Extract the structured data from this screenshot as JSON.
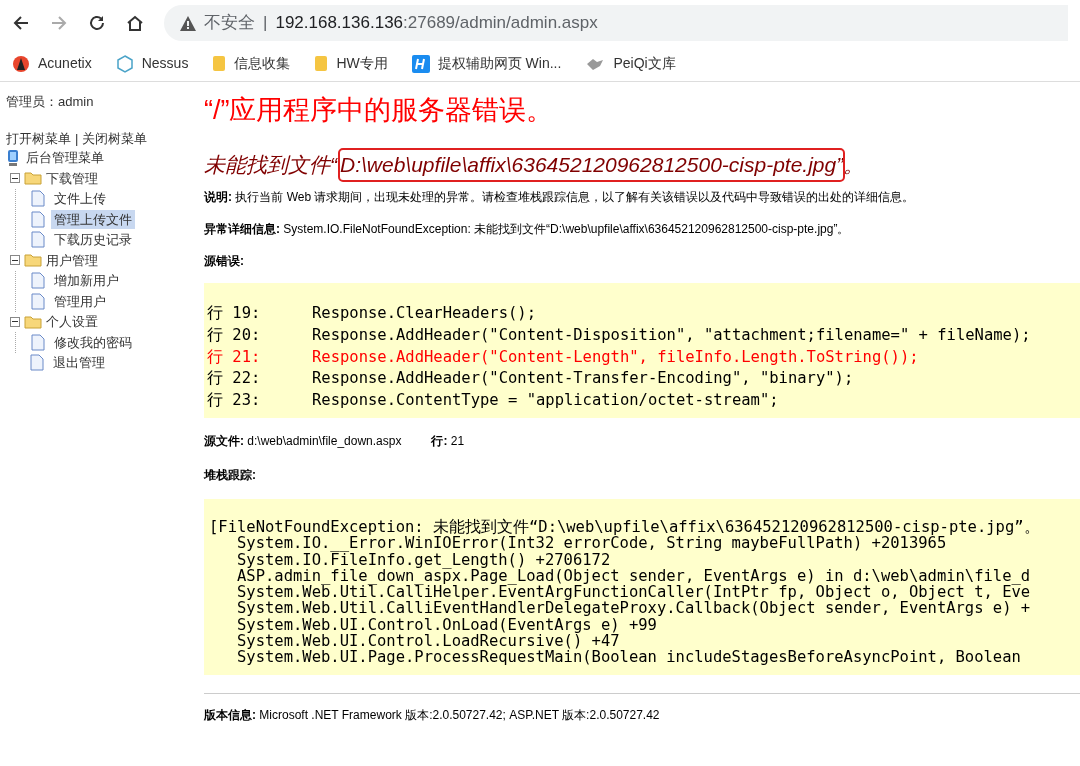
{
  "browser": {
    "security_label": "不安全",
    "separator": "|",
    "url_host": "192.168.136.136",
    "url_rest": ":27689/admin/admin.aspx"
  },
  "bookmarks": [
    {
      "kind": "acunetix",
      "label": "Acunetix"
    },
    {
      "kind": "hexagon",
      "label": "Nessus"
    },
    {
      "kind": "folder",
      "label": "信息收集"
    },
    {
      "kind": "folder",
      "label": "HW专用"
    },
    {
      "kind": "h",
      "label": "提权辅助网页 Win..."
    },
    {
      "kind": "bird",
      "label": "PeiQi文库"
    }
  ],
  "sidebar": {
    "admin_label": "管理员：admin",
    "open_link": "打开树菜单",
    "divider": "|",
    "close_link": "关闭树菜单",
    "root": "后台管理菜单",
    "tree": [
      {
        "label": "下载管理",
        "expanded": true,
        "children": [
          {
            "label": "文件上传",
            "selected": false
          },
          {
            "label": "管理上传文件",
            "selected": true
          },
          {
            "label": "下载历史记录",
            "selected": false
          }
        ]
      },
      {
        "label": "用户管理",
        "expanded": true,
        "children": [
          {
            "label": "增加新用户",
            "selected": false
          },
          {
            "label": "管理用户",
            "selected": false
          }
        ]
      },
      {
        "label": "个人设置",
        "expanded": true,
        "children": [
          {
            "label": "修改我的密码",
            "selected": false
          }
        ]
      }
    ],
    "leaf": "退出管理"
  },
  "error": {
    "title": "“/”应用程序中的服务器错误。",
    "heading_prefix": "未能找到文件“",
    "heading_highlight": "D:\\web\\upfile\\affix\\636452120962812500-cisp-pte.jpg”",
    "heading_suffix": "。",
    "description": "**说明:** 执行当前 Web 请求期间，出现未处理的异常。请检查堆栈跟踪信息，以了解有关该错误以及代码中导致错误的出处的详细信息。",
    "exception": "**异常详细信息:** System.IO.FileNotFoundException: 未能找到文件“D:\\web\\upfile\\affix\\636452120962812500-cisp-pte.jpg”。",
    "source_label": "源错误:",
    "source_lines": [
      {
        "number": "行 19:",
        "code": "Response.ClearHeaders();",
        "error": false
      },
      {
        "number": "行 20:",
        "code": "Response.AddHeader(\"Content-Disposition\", \"attachment;filename=\" + fileName);",
        "error": false
      },
      {
        "number": "行 21:",
        "code": "Response.AddHeader(\"Content-Length\", fileInfo.Length.ToString());",
        "error": true
      },
      {
        "number": "行 22:",
        "code": "Response.AddHeader(\"Content-Transfer-Encoding\", \"binary\");",
        "error": false
      },
      {
        "number": "行 23:",
        "code": "Response.ContentType = \"application/octet-stream\";",
        "error": false
      }
    ],
    "source_file": "**源文件:** d:\\web\\admin\\file_down.aspx",
    "source_line": "**行:** 21",
    "stack_label": "堆栈跟踪:",
    "stack_lines": [
      "[FileNotFoundException: 未能找到文件“D:\\web\\upfile\\affix\\636452120962812500-cisp-pte.jpg”。",
      "   System.IO.__Error.WinIOError(Int32 errorCode, String maybeFullPath) +2013965",
      "   System.IO.FileInfo.get_Length() +2706172",
      "   ASP.admin_file_down_aspx.Page_Load(Object sender, EventArgs e) in d:\\web\\admin\\file_d",
      "   System.Web.Util.CalliHelper.EventArgFunctionCaller(IntPtr fp, Object o, Object t, Eve",
      "   System.Web.Util.CalliEventHandlerDelegateProxy.Callback(Object sender, EventArgs e) +",
      "   System.Web.UI.Control.OnLoad(EventArgs e) +99",
      "   System.Web.UI.Control.LoadRecursive() +47",
      "   System.Web.UI.Page.ProcessRequestMain(Boolean includeStagesBeforeAsyncPoint, Boolean"
    ],
    "version": "**版本信息:** Microsoft .NET Framework 版本:2.0.50727.42; ASP.NET 版本:2.0.50727.42"
  }
}
